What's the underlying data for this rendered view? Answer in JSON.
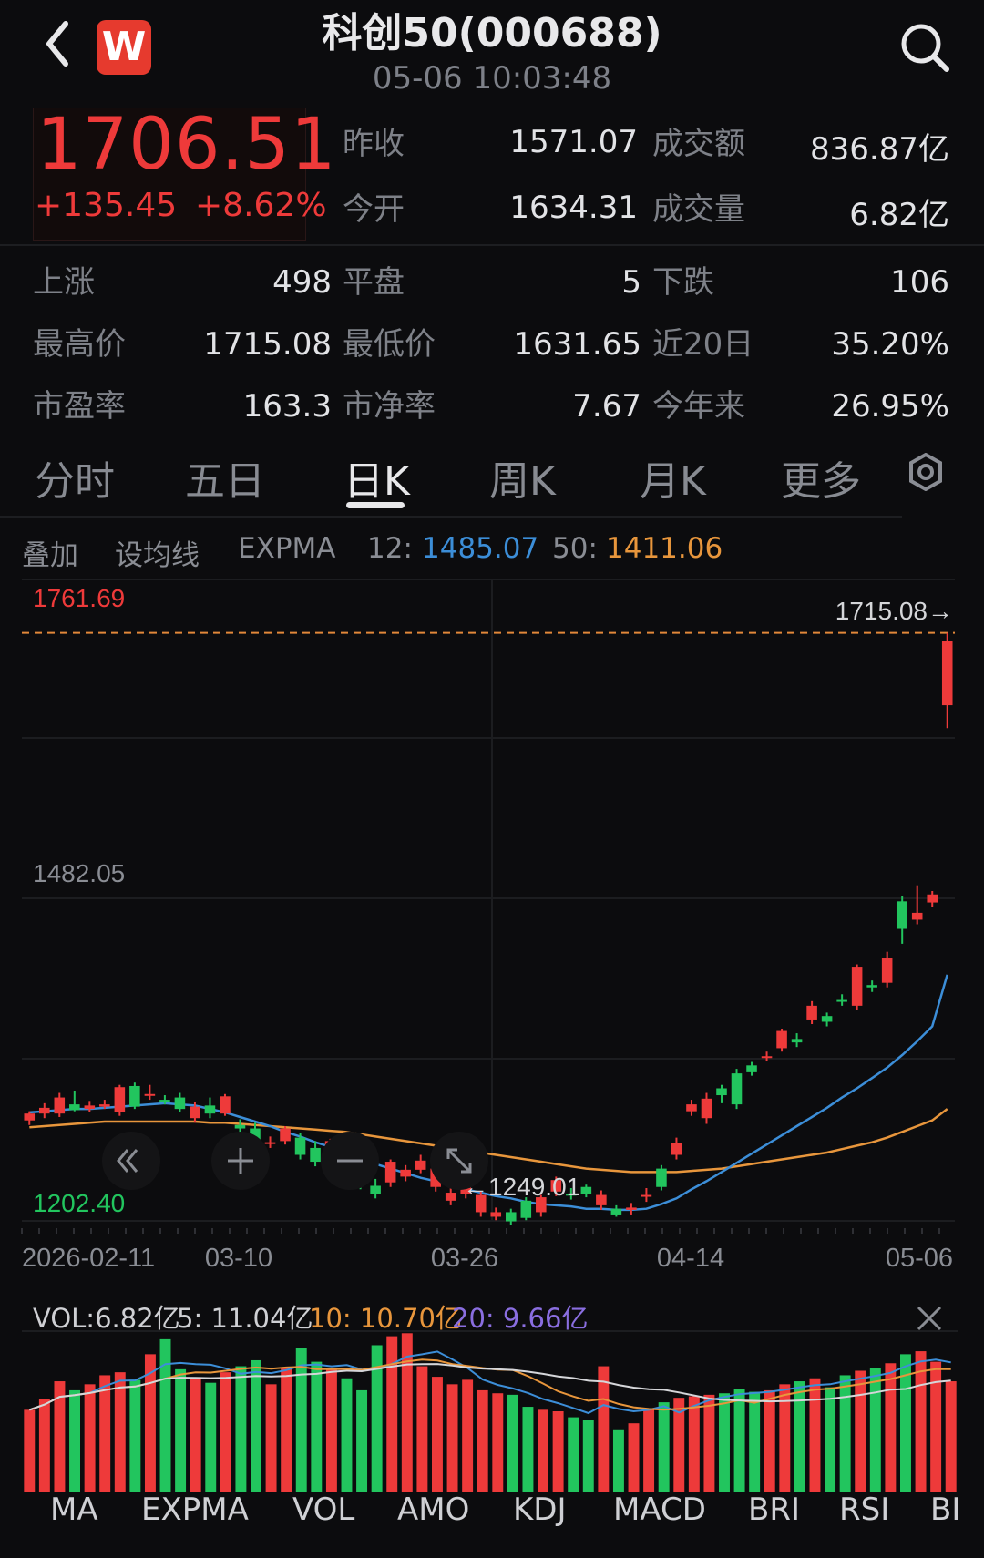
{
  "header": {
    "title": "科创50(000688)",
    "time": "05-06 10:03:48"
  },
  "quote": {
    "price": "1706.51",
    "change": "+135.45",
    "change_pct": "+8.62%",
    "fields": [
      {
        "label": "昨收",
        "value": "1571.07"
      },
      {
        "label": "成交额",
        "value": "836.87亿"
      },
      {
        "label": "今开",
        "value": "1634.31"
      },
      {
        "label": "成交量",
        "value": "6.82亿"
      }
    ]
  },
  "stats": [
    {
      "label": "上涨",
      "value": "498"
    },
    {
      "label": "平盘",
      "value": "5"
    },
    {
      "label": "下跌",
      "value": "106"
    },
    {
      "label": "最高价",
      "value": "1715.08"
    },
    {
      "label": "最低价",
      "value": "1631.65"
    },
    {
      "label": "近20日",
      "value": "35.20%"
    },
    {
      "label": "市盈率",
      "value": "163.3"
    },
    {
      "label": "市净率",
      "value": "7.67"
    },
    {
      "label": "今年来",
      "value": "26.95%"
    }
  ],
  "tabs": [
    "分时",
    "五日",
    "日K",
    "周K",
    "月K",
    "更多"
  ],
  "active_tab": "日K",
  "indicator_bar": {
    "overlay": "叠加",
    "set_ma": "设均线",
    "name": "EXPMA",
    "p1_label": "12:",
    "p1_value": "1485.07",
    "p2_label": "50:",
    "p2_value": "1411.06"
  },
  "kline": {
    "top_label": "1761.69",
    "high_label": "1715.08→",
    "mid_label": "1482.05",
    "low_label": "←1249.01",
    "bottom_label": "1202.40",
    "dates": [
      "2026-02-11",
      "03-10",
      "03-26",
      "04-14",
      "05-06"
    ]
  },
  "volume": {
    "vol": "VOL:6.82亿",
    "ma5": "5: 11.04亿",
    "ma10": "10: 10.70亿",
    "ma20": "20: 9.66亿"
  },
  "bottom_tabs": [
    "MA",
    "EXPMA",
    "VOL",
    "AMO",
    "KDJ",
    "MACD",
    "BRI",
    "RSI",
    "BI"
  ],
  "colors": {
    "up": "#ee3a3a",
    "down": "#22c55e",
    "ema12": "#3c8ed8",
    "ema50": "#e8963c",
    "ma20": "#8a6ee0"
  },
  "chart_data": {
    "type": "candlestick",
    "title": "",
    "ylim": [
      1202.4,
      1761.69
    ],
    "ohlc_open": [
      1290,
      1296,
      1296,
      1304,
      1300,
      1302,
      1297,
      1320,
      1313,
      1308,
      1310,
      1292,
      1303,
      1296,
      1286,
      1283,
      1271,
      1272,
      1275,
      1266,
      1253,
      1261,
      1242,
      1233,
      1236,
      1241,
      1247,
      1232,
      1220,
      1226,
      1210,
      1206,
      1210,
      1220,
      1210,
      1228,
      1226,
      1232,
      1216,
      1213,
      1212,
      1225,
      1248,
      1260,
      1298,
      1292,
      1318,
      1331,
      1338,
      1346,
      1353,
      1361,
      1378,
      1381,
      1395,
      1390,
      1408,
      1410,
      1481,
      1465,
      1480,
      1652
    ],
    "ohlc_close": [
      1296,
      1301,
      1310,
      1299,
      1303,
      1304,
      1319,
      1302,
      1313,
      1307,
      1300,
      1302,
      1296,
      1311,
      1283,
      1270,
      1271,
      1283,
      1260,
      1254,
      1272,
      1246,
      1234,
      1226,
      1254,
      1247,
      1255,
      1248,
      1227,
      1234,
      1225,
      1210,
      1202,
      1205,
      1223,
      1238,
      1225,
      1226,
      1225,
      1208,
      1214,
      1225,
      1232,
      1270,
      1304,
      1309,
      1312,
      1304,
      1332,
      1346,
      1368,
      1358,
      1390,
      1376,
      1394,
      1424,
      1406,
      1432,
      1457,
      1471,
      1487,
      1708
    ],
    "ohlc_high": [
      1298,
      1305,
      1314,
      1316,
      1307,
      1308,
      1321,
      1323,
      1321,
      1312,
      1314,
      1306,
      1310,
      1313,
      1291,
      1288,
      1276,
      1285,
      1279,
      1272,
      1274,
      1264,
      1245,
      1239,
      1256,
      1251,
      1260,
      1250,
      1231,
      1238,
      1228,
      1214,
      1213,
      1223,
      1225,
      1241,
      1231,
      1234,
      1229,
      1216,
      1218,
      1231,
      1251,
      1275,
      1308,
      1314,
      1321,
      1335,
      1341,
      1350,
      1370,
      1366,
      1394,
      1384,
      1400,
      1426,
      1412,
      1437,
      1486,
      1495,
      1490,
      1715
    ],
    "ohlc_low": [
      1286,
      1292,
      1293,
      1298,
      1297,
      1300,
      1294,
      1300,
      1308,
      1304,
      1297,
      1288,
      1292,
      1294,
      1278,
      1266,
      1266,
      1269,
      1256,
      1250,
      1251,
      1242,
      1230,
      1222,
      1232,
      1237,
      1244,
      1228,
      1216,
      1222,
      1206,
      1203,
      1199,
      1203,
      1206,
      1224,
      1221,
      1223,
      1212,
      1206,
      1208,
      1219,
      1229,
      1256,
      1294,
      1287,
      1305,
      1300,
      1329,
      1342,
      1350,
      1354,
      1374,
      1372,
      1390,
      1386,
      1402,
      1406,
      1444,
      1461,
      1476,
      1632
    ],
    "ema12": [
      1297,
      1298,
      1299,
      1300,
      1300,
      1301,
      1302,
      1303,
      1304,
      1305,
      1304,
      1303,
      1300,
      1297,
      1293,
      1289,
      1285,
      1280,
      1276,
      1271,
      1267,
      1262,
      1257,
      1252,
      1248,
      1244,
      1240,
      1237,
      1233,
      1230,
      1227,
      1224,
      1222,
      1219,
      1217,
      1216,
      1215,
      1213,
      1213,
      1212,
      1212,
      1213,
      1217,
      1222,
      1230,
      1237,
      1245,
      1253,
      1261,
      1269,
      1277,
      1285,
      1293,
      1301,
      1310,
      1318,
      1327,
      1336,
      1347,
      1359,
      1372,
      1417
    ],
    "ema50": [
      1284,
      1285,
      1286,
      1287,
      1288,
      1289,
      1289,
      1289,
      1289,
      1289,
      1289,
      1289,
      1288,
      1288,
      1287,
      1286,
      1285,
      1284,
      1283,
      1282,
      1281,
      1280,
      1278,
      1276,
      1274,
      1272,
      1270,
      1268,
      1266,
      1264,
      1262,
      1260,
      1258,
      1256,
      1254,
      1252,
      1250,
      1248,
      1247,
      1246,
      1245,
      1245,
      1245,
      1245,
      1246,
      1247,
      1248,
      1250,
      1252,
      1254,
      1256,
      1258,
      1260,
      1262,
      1265,
      1268,
      1271,
      1275,
      1280,
      1285,
      1290,
      1300
    ],
    "volume": [
      5.5,
      6.2,
      7.4,
      6.8,
      7.2,
      7.8,
      8.0,
      7.5,
      9.2,
      10.2,
      8.2,
      7.6,
      7.3,
      8.0,
      8.4,
      8.8,
      7.2,
      8.3,
      9.6,
      8.7,
      8.2,
      7.6,
      6.8,
      9.8,
      10.4,
      10.6,
      8.4,
      7.7,
      7.2,
      7.5,
      6.8,
      6.6,
      6.5,
      5.7,
      5.5,
      5.4,
      5.0,
      4.8,
      8.4,
      4.2,
      4.6,
      5.5,
      6.0,
      6.3,
      6.4,
      6.5,
      6.6,
      6.9,
      6.7,
      6.8,
      7.2,
      7.4,
      7.6,
      7.0,
      7.8,
      8.1,
      8.3,
      8.6,
      9.2,
      9.4,
      8.7,
      7.4
    ],
    "dates": [
      "2026-02-11",
      "03-10",
      "03-26",
      "04-14",
      "05-06"
    ]
  }
}
